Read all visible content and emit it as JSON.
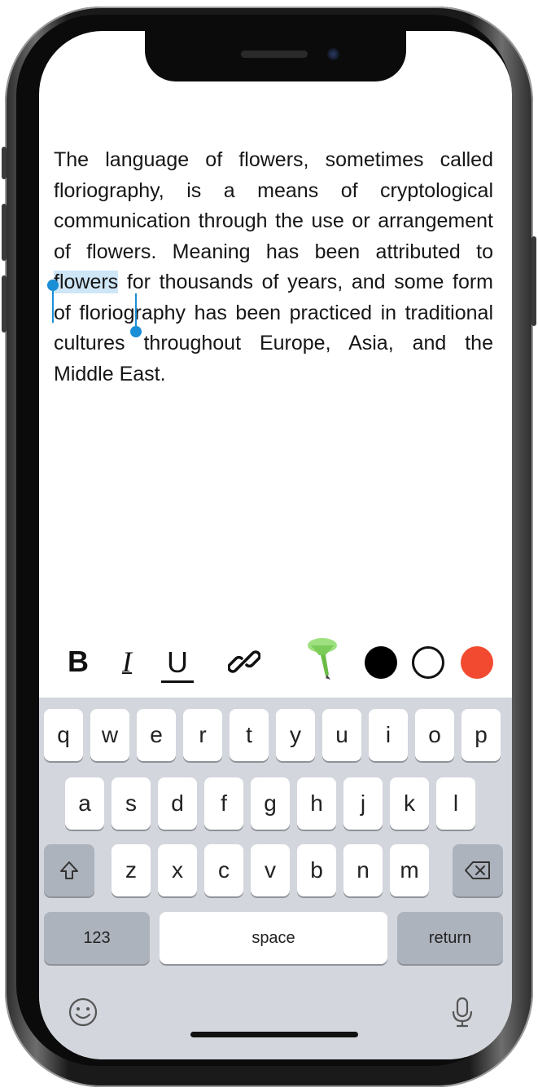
{
  "article": {
    "before": "The language of flowers, sometimes called floriography, is a means of cryptological communication through the use or arrangement of flowers. Meaning has been attributed to ",
    "selected": "flowers",
    "after": " for thousands of years, and some form of floriography has been practiced in traditional cultures throughout Europe, Asia, and the Middle East."
  },
  "toolbar": {
    "bold": "B",
    "italic": "I",
    "underline": "U",
    "link_icon": "link-icon",
    "highlighter_icon": "highlighter-icon",
    "colors": {
      "black": "#000000",
      "white": "#ffffff",
      "red": "#f24a30"
    },
    "selection_color": "#cfe6f6",
    "handle_color": "#1a8fd6"
  },
  "keyboard": {
    "row1": [
      "q",
      "w",
      "e",
      "r",
      "t",
      "y",
      "u",
      "i",
      "o",
      "p"
    ],
    "row2": [
      "a",
      "s",
      "d",
      "f",
      "g",
      "h",
      "j",
      "k",
      "l"
    ],
    "row3": [
      "z",
      "x",
      "c",
      "v",
      "b",
      "n",
      "m"
    ],
    "numbers": "123",
    "space": "space",
    "return": "return",
    "shift_icon": "shift-icon",
    "backspace_icon": "backspace-icon",
    "emoji_icon": "emoji-icon",
    "mic_icon": "microphone-icon"
  }
}
